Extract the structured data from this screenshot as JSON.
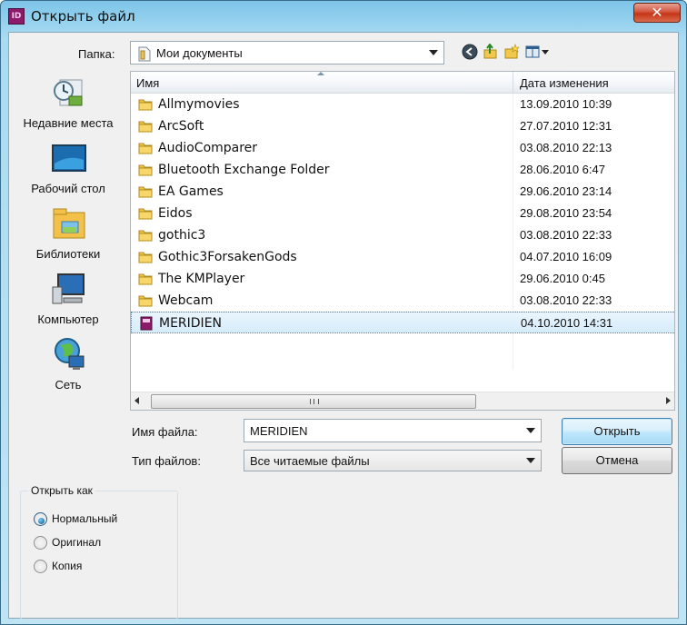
{
  "window": {
    "title": "Открыть файл",
    "app_icon_text": "ID",
    "close_label": "✕"
  },
  "folder": {
    "label": "Папка:",
    "value": "Мои документы"
  },
  "toolbar": {
    "icons": [
      "back-icon",
      "up-folder-icon",
      "new-folder-icon",
      "view-menu-icon"
    ]
  },
  "places": [
    {
      "label": "Недавние места",
      "icon": "recent-places-icon"
    },
    {
      "label": "Рабочий стол",
      "icon": "desktop-icon"
    },
    {
      "label": "Библиотеки",
      "icon": "libraries-icon"
    },
    {
      "label": "Компьютер",
      "icon": "computer-icon"
    },
    {
      "label": "Сеть",
      "icon": "network-icon"
    }
  ],
  "filelist": {
    "columns": {
      "name": "Имя",
      "date": "Дата изменения"
    },
    "rows": [
      {
        "name": "Allmymovies",
        "date": "13.09.2010 10:39",
        "type": "folder"
      },
      {
        "name": "ArcSoft",
        "date": "27.07.2010 12:31",
        "type": "folder"
      },
      {
        "name": "AudioComparer",
        "date": "03.08.2010 22:13",
        "type": "folder"
      },
      {
        "name": "Bluetooth Exchange Folder",
        "date": "28.06.2010 6:47",
        "type": "folder"
      },
      {
        "name": "EA Games",
        "date": "29.06.2010 23:14",
        "type": "folder"
      },
      {
        "name": "Eidos",
        "date": "29.08.2010 23:54",
        "type": "folder"
      },
      {
        "name": "gothic3",
        "date": "03.08.2010 22:33",
        "type": "folder"
      },
      {
        "name": "Gothic3ForsakenGods",
        "date": "04.07.2010 16:09",
        "type": "folder"
      },
      {
        "name": "The KMPlayer",
        "date": "29.06.2010 0:45",
        "type": "folder"
      },
      {
        "name": "Webcam",
        "date": "03.08.2010 22:33",
        "type": "folder"
      },
      {
        "name": "MERIDIEN",
        "date": "04.10.2010 14:31",
        "type": "indesign",
        "selected": true
      }
    ]
  },
  "filename": {
    "label": "Имя файла:",
    "value": "MERIDIEN"
  },
  "filetype": {
    "label": "Тип файлов:",
    "value": "Все читаемые файлы"
  },
  "buttons": {
    "open": "Открыть",
    "cancel": "Отмена"
  },
  "open_as": {
    "title": "Открыть как",
    "options": [
      {
        "label": "Нормальный",
        "checked": true
      },
      {
        "label": "Оригинал",
        "checked": false
      },
      {
        "label": "Копия",
        "checked": false
      }
    ]
  },
  "colors": {
    "accent": "#3c7fb1",
    "title_bar": "#a9dbf2",
    "close": "#c53516",
    "selection": "#d6ecfb"
  }
}
